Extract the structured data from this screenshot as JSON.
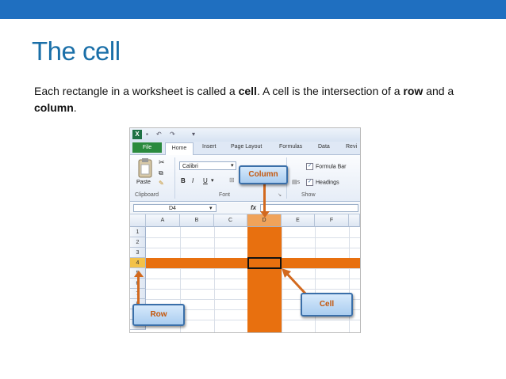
{
  "slide": {
    "title": "The cell",
    "para": {
      "p1": "Each rectangle in a worksheet is called a ",
      "b1": "cell",
      "p2": ". A cell is the intersection of a ",
      "b2": "row",
      "p3": " and a ",
      "b3": "column",
      "p4": "."
    },
    "top_bar_color": "#1f6fc0"
  },
  "excel": {
    "tabs": [
      "File",
      "Home",
      "Insert",
      "Page Layout",
      "Formulas",
      "Data",
      "Revi"
    ],
    "clipboard_group": "Clipboard",
    "paste_label": "Paste",
    "font_name": "Calibri",
    "font_group": "Font",
    "show_group": "Show",
    "bold": "B",
    "italic": "I",
    "underline": "U",
    "formula_bar_label": "Formula Bar",
    "headings_label": "Headings",
    "name_box": "D4",
    "fx_label": "fx",
    "columns": [
      "A",
      "B",
      "C",
      "D",
      "E",
      "F"
    ],
    "rows": [
      "1",
      "2",
      "3",
      "4",
      "5",
      "6",
      "7",
      "8",
      "9",
      "10"
    ],
    "highlight_color": "#e8700f"
  },
  "callouts": {
    "column": "Column",
    "row": "Row",
    "cell": "Cell"
  }
}
